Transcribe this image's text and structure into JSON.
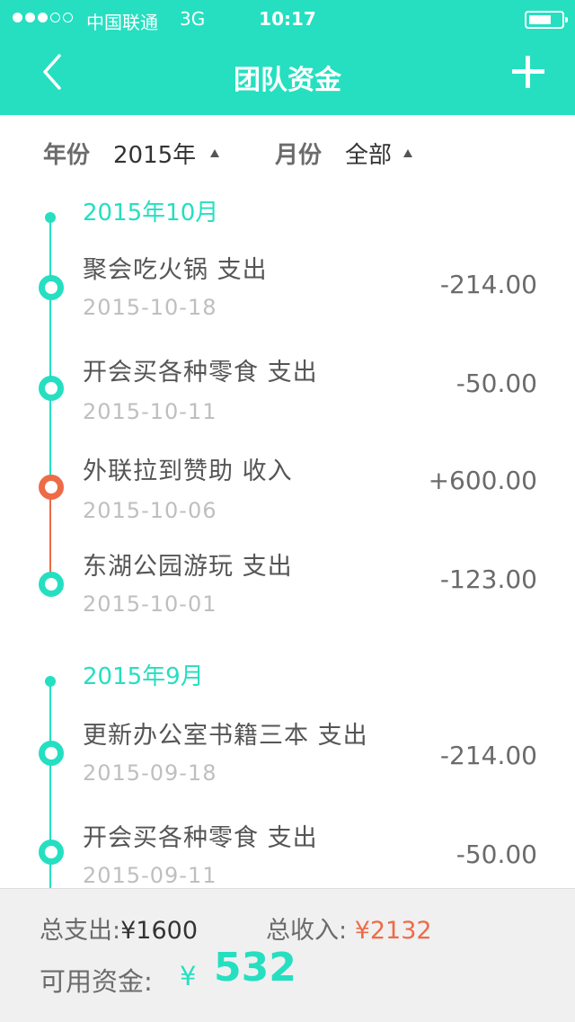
{
  "status": {
    "carrier": "中国联通",
    "network": "3G",
    "time": "10:17",
    "icons": [
      "signal-dots-icon",
      "battery-icon"
    ]
  },
  "nav": {
    "title": "团队资金",
    "icons": [
      "back-chevron-icon",
      "plus-icon"
    ]
  },
  "filters": {
    "year_label": "年份",
    "year_value": "2015年",
    "month_label": "月份",
    "month_value": "全部"
  },
  "groups": [
    {
      "month": "2015年10月",
      "entries": [
        {
          "title": "聚会吃火锅 支出",
          "date": "2015-10-18",
          "amount": "-214.00",
          "type": "expense"
        },
        {
          "title": "开会买各种零食 支出",
          "date": "2015-10-11",
          "amount": "-50.00",
          "type": "expense"
        },
        {
          "title": "外联拉到赞助 收入",
          "date": "2015-10-06",
          "amount": "+600.00",
          "type": "income"
        },
        {
          "title": "东湖公园游玩 支出",
          "date": "2015-10-01",
          "amount": "-123.00",
          "type": "expense"
        }
      ]
    },
    {
      "month": "2015年9月",
      "entries": [
        {
          "title": "更新办公室书籍三本 支出",
          "date": "2015-09-18",
          "amount": "-214.00",
          "type": "expense"
        },
        {
          "title": "开会买各种零食 支出",
          "date": "2015-09-11",
          "amount": "-50.00",
          "type": "expense"
        }
      ]
    }
  ],
  "summary": {
    "total_expense_label": "总支出:",
    "total_expense_value": "¥1600",
    "total_income_label": "总收入:",
    "total_income_value": "¥2132",
    "available_label": "可用资金:",
    "available_currency": "¥",
    "available_value": "532"
  },
  "colors": {
    "accent": "#25dfc0",
    "income": "#ee6b47"
  }
}
